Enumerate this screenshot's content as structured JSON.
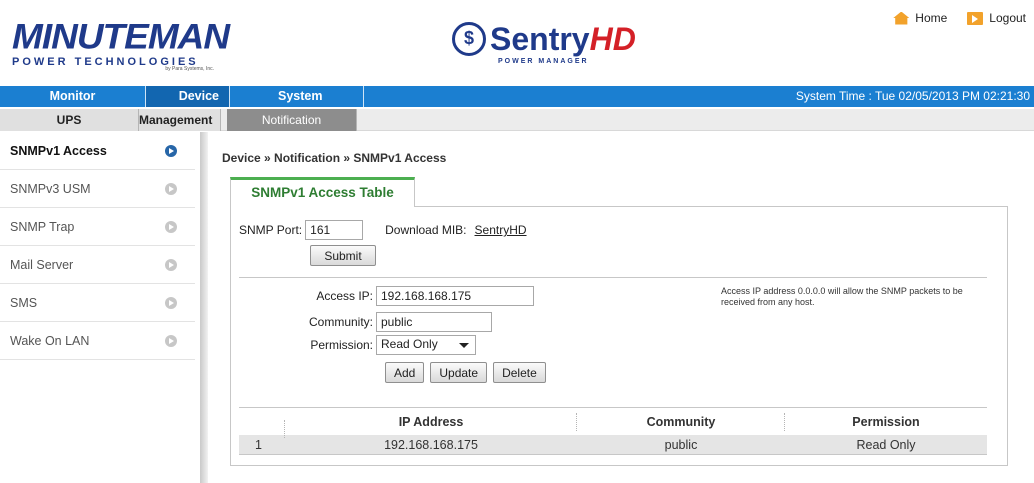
{
  "header": {
    "brand_big": "MINUTEMAN",
    "brand_sub": "POWER TECHNOLOGIES",
    "brand_para": "by Para Systems, Inc.",
    "product_mark": "$",
    "product_name": "Sentry",
    "product_hd": "HD",
    "product_sub": "POWER MANAGER",
    "home_label": "Home",
    "logout_label": "Logout"
  },
  "mainnav": {
    "items": [
      "Monitor",
      "Device",
      "System"
    ],
    "system_time": "System Time : Tue 02/05/2013 PM 02:21:30"
  },
  "subnav": {
    "items": [
      "UPS",
      "Management",
      "Notification"
    ]
  },
  "sidebar": {
    "items": [
      {
        "label": "SNMPv1 Access"
      },
      {
        "label": "SNMPv3 USM"
      },
      {
        "label": "SNMP Trap"
      },
      {
        "label": "Mail Server"
      },
      {
        "label": "SMS"
      },
      {
        "label": "Wake On LAN"
      }
    ]
  },
  "content": {
    "breadcrumb": "Device » Notification » SNMPv1 Access",
    "tab_title": "SNMPv1 Access Table",
    "snmp_port_label": "SNMP Port:",
    "snmp_port_value": "161",
    "download_mib_label": "Download MIB:",
    "download_mib_link": "SentryHD",
    "submit_label": "Submit",
    "access_ip_label": "Access IP:",
    "access_ip_value": "192.168.168.175",
    "community_label": "Community:",
    "community_value": "public",
    "permission_label": "Permission:",
    "permission_value": "Read Only",
    "add_label": "Add",
    "update_label": "Update",
    "delete_label": "Delete",
    "note": "Access IP address 0.0.0.0 will allow the SNMP packets to be received from any host."
  },
  "table": {
    "headers": [
      "",
      "IP Address",
      "Community",
      "Permission"
    ],
    "rows": [
      [
        "1",
        "192.168.168.175",
        "public",
        "Read Only"
      ]
    ]
  },
  "colors": {
    "nav_blue": "#1b7fd1",
    "nav_active": "#1266b0",
    "tab_green": "#4caf50",
    "brand_blue": "#1f3a8a",
    "brand_red": "#d42027"
  }
}
